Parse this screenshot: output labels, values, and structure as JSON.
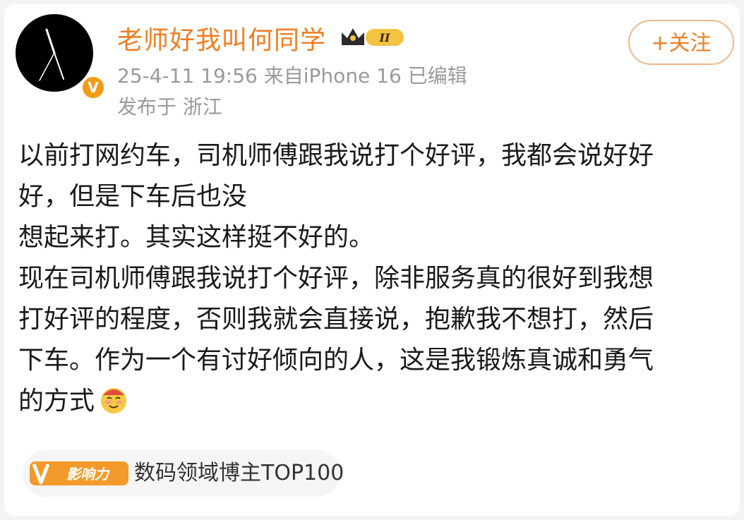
{
  "post": {
    "author": {
      "name": "老师好我叫何同学",
      "rank_badge": "II",
      "verified_badge": "V"
    },
    "meta": "25-4-11 19:56  来自iPhone 16  已编辑",
    "location": "发布于 浙江",
    "follow_label": "+关注",
    "content_lines": [
      "以前打网约车，司机师傅跟我说打个好评，我都会说好好",
      "好，但是下车后也没",
      "想起来打。其实这样挺不好的。",
      "现在司机师傅跟我说打个好评，除非服务真的很好到我想",
      "打好评的程度，否则我就会直接说，抱歉我不想打，然后",
      "下车。作为一个有讨好倾向的人，这是我锻炼真诚和勇气",
      "的方式"
    ],
    "emoji": "embarrassed-smile-emoji",
    "tag": {
      "badge": "影响力",
      "label": "数码领域博主TOP100"
    }
  },
  "colors": {
    "username": "#f07e23",
    "meta": "#9a9a9a",
    "accent": "#f19b15"
  }
}
